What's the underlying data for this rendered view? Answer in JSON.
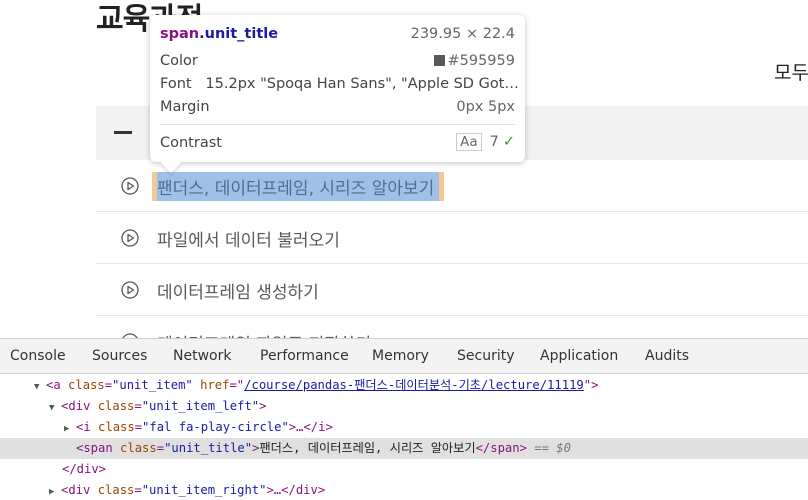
{
  "page": {
    "title": "교육과정",
    "view_all": "모두",
    "units": [
      {
        "title": "팬더스, 데이터프레임, 시리즈 알아보기",
        "highlighted": true
      },
      {
        "title": "파일에서 데이터 불러오기",
        "highlighted": false
      },
      {
        "title": "데이터프레임 생성하기",
        "highlighted": false
      },
      {
        "title": "데이터프레임 파일로 저장하기",
        "highlighted": false
      }
    ]
  },
  "tooltip": {
    "element": "span",
    "class": ".unit_title",
    "size": "239.95 × 22.4",
    "color_label": "Color",
    "color_value": "#595959",
    "font_label": "Font",
    "font_value": "15.2px \"Spoqa Han Sans\", \"Apple SD Got…",
    "margin_label": "Margin",
    "margin_value": "0px 5px",
    "contrast_label": "Contrast",
    "contrast_aa": "Aa",
    "contrast_value": "7",
    "check": "✓"
  },
  "devtools": {
    "tabs": [
      "Console",
      "Sources",
      "Network",
      "Performance",
      "Memory",
      "Security",
      "Application",
      "Audits"
    ],
    "dom": {
      "line1": {
        "tag_open": "<a ",
        "attr1": "class",
        "val1": "\"unit_item\"",
        "attr2": "href",
        "eq": "=\"",
        "link": "/course/pandas-팬더스-데이터분석-기초/lecture/11119",
        "close": "\">"
      },
      "line2": {
        "tag_open": "<div ",
        "attr": "class",
        "val": "\"unit_item_left\"",
        "close": ">"
      },
      "line3": {
        "tag_open": "<i ",
        "attr": "class",
        "val": "\"fal fa-play-circle\"",
        "mid": ">…</",
        "end": "i>"
      },
      "line4": {
        "tag_open": "<span ",
        "attr": "class",
        "val": "\"unit_title\"",
        "close": ">",
        "text": "팬더스, 데이터프레임, 시리즈 알아보기",
        "tag_close": "</span>",
        "dollar": " == $0"
      },
      "line5": {
        "tag": "</div>"
      },
      "line6": {
        "tag_open": "<div ",
        "attr": "class",
        "val": "\"unit_item_right\"",
        "mid": ">…</",
        "end": "div>"
      }
    }
  },
  "colors": {
    "selection": "#9fc1e6",
    "margin_overlay": "#f5c996",
    "text_color": "#595959"
  }
}
